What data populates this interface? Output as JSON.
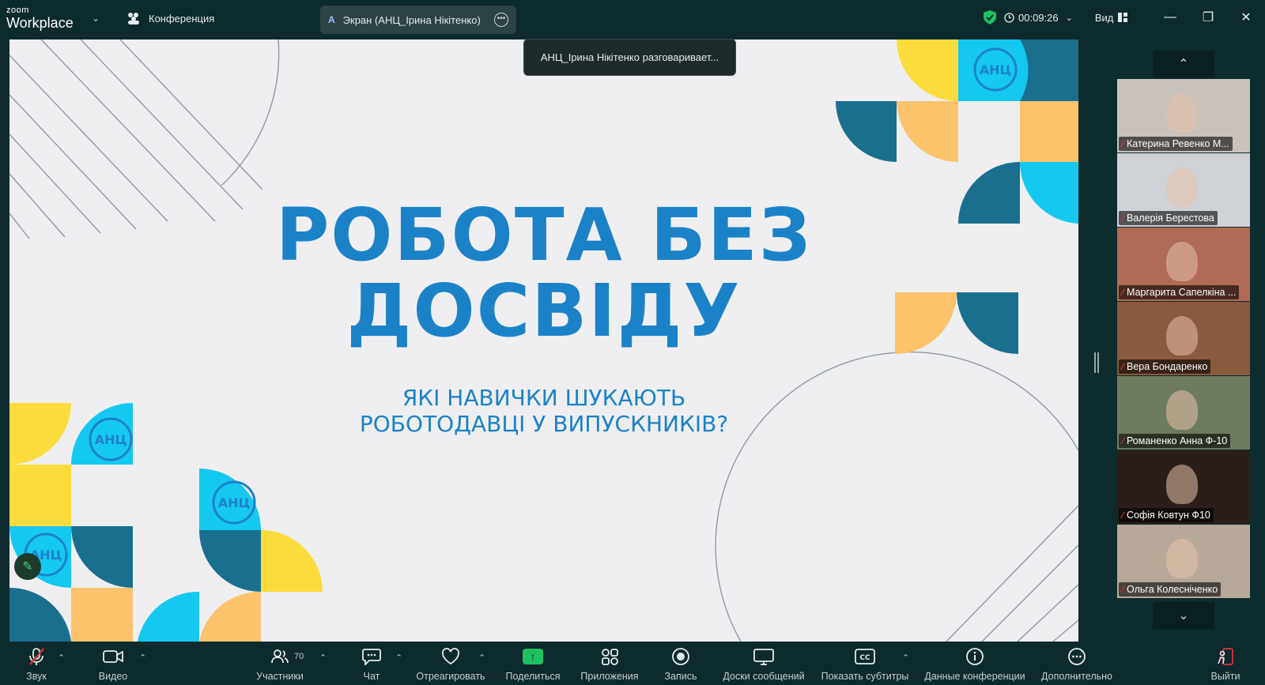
{
  "app": {
    "logo_small": "zoom",
    "logo_big": "Workplace",
    "meeting_title": "Конференция"
  },
  "share_bar": {
    "letter": "A",
    "label": "Экран (АНЦ_Ірина Нікітенко)"
  },
  "status": {
    "timer": "00:09:26",
    "view_label": "Вид"
  },
  "toast": "АНЦ_Ірина Нікітенко разговаривает...",
  "slide": {
    "title_line1": "РОБОТА БЕЗ",
    "title_line2": "ДОСВІДУ",
    "subtitle_line1": "ЯКІ НАВИЧКИ ШУКАЮТЬ",
    "subtitle_line2": "РОБОТОДАВЦІ У ВИПУСКНИКІВ?",
    "logo_text": "АНЦ"
  },
  "participants": [
    {
      "name": "Катерина Ревенко  М...",
      "bg": "#c9c2bd"
    },
    {
      "name": "Валерія  Берестова",
      "bg": "#cfd2d6"
    },
    {
      "name": "Маргарита Сапелкіна ...",
      "bg": "#b06a55"
    },
    {
      "name": "Вера Бондаренко",
      "bg": "#8a5a3c"
    },
    {
      "name": "Романенко Анна Ф-10",
      "bg": "#6f7b60"
    },
    {
      "name": "Софія Ковтун Ф10",
      "bg": "#2a1e1a"
    },
    {
      "name": "Ольга Колесніченко",
      "bg": "#b6a99a"
    }
  ],
  "toolbar": {
    "audio": "Звук",
    "video": "Видео",
    "participants": "Участники",
    "participants_count": "70",
    "chat": "Чат",
    "react": "Отреагировать",
    "share": "Поделиться",
    "apps": "Приложения",
    "record": "Запись",
    "whiteboards": "Доски сообщений",
    "captions": "Показать субтитры",
    "info": "Данные конференции",
    "more": "Дополнительно",
    "leave": "Выйти"
  },
  "colors": {
    "slide_blue": "#1b82c8",
    "yellow": "#fcdc3c",
    "cyan": "#15c8f0",
    "teal": "#1a6f8e",
    "peach": "#fdc36c",
    "share_green": "#1fc05f"
  }
}
